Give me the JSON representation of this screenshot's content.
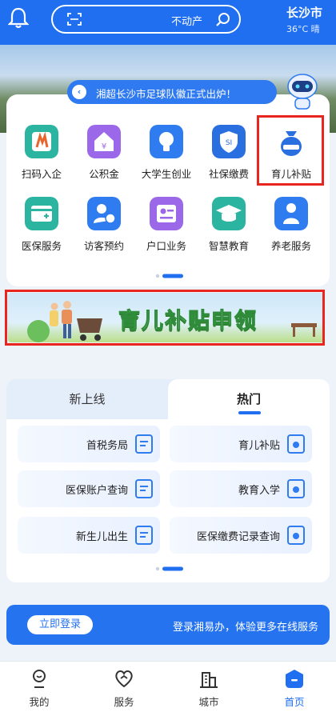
{
  "header": {
    "city": "长沙市",
    "weather": "36°C 晴",
    "search_placeholder": "不动产"
  },
  "notice": "湘超长沙市足球队徽正式出炉！",
  "services": [
    {
      "label": "育儿补贴",
      "icon": "money-bag-icon",
      "color": "#2a6fe0"
    },
    {
      "label": "社保缴费",
      "icon": "shield-icon",
      "color": "#2a6fe0"
    },
    {
      "label": "大学生创业",
      "icon": "lightbulb-icon",
      "color": "#2f7bf0"
    },
    {
      "label": "公积金",
      "icon": "house-fund-icon",
      "color": "#9a68e8"
    },
    {
      "label": "扫码入企",
      "icon": "qr-company-icon",
      "color": "#2bb4a0"
    },
    {
      "label": "养老服务",
      "icon": "elderly-icon",
      "color": "#2f7bf0"
    },
    {
      "label": "智慧教育",
      "icon": "graduation-cap-icon",
      "color": "#2bb4a0"
    },
    {
      "label": "户口业务",
      "icon": "id-card-icon",
      "color": "#9a68e8"
    },
    {
      "label": "访客预约",
      "icon": "visitor-clock-icon",
      "color": "#2f7bf0"
    },
    {
      "label": "医保服务",
      "icon": "medical-card-icon",
      "color": "#2bb4a0"
    }
  ],
  "promo_title": "育儿补贴申领",
  "tabs": {
    "hot": "热门",
    "new": "新上线"
  },
  "hot_services": [
    {
      "label": "育儿补贴"
    },
    {
      "label": "首税务局"
    },
    {
      "label": "教育入学"
    },
    {
      "label": "医保账户查询"
    },
    {
      "label": "医保缴费记录查询"
    },
    {
      "label": "新生儿出生"
    }
  ],
  "login": {
    "text": "登录湘易办，体验更多在线服务",
    "button": "立即登录"
  },
  "nav": [
    {
      "label": "首页",
      "icon": "home-icon",
      "active": true
    },
    {
      "label": "城市",
      "icon": "city-icon",
      "active": false
    },
    {
      "label": "服务",
      "icon": "heart-service-icon",
      "active": false
    },
    {
      "label": "我的",
      "icon": "profile-icon",
      "active": false
    }
  ],
  "colors": {
    "primary": "#1f6ff0",
    "highlight": "#e8261f"
  }
}
